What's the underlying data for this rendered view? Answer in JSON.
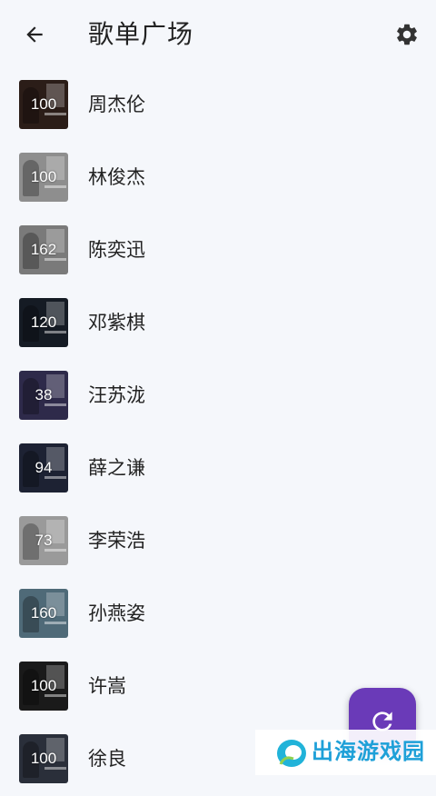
{
  "appbar": {
    "title": "歌单广场",
    "back_icon": "arrow-back-icon",
    "settings_icon": "gear-icon"
  },
  "playlists": [
    {
      "count": "100",
      "name": "周杰伦",
      "color": "#2b1d18"
    },
    {
      "count": "100",
      "name": "林俊杰",
      "color": "#8e8e8e"
    },
    {
      "count": "162",
      "name": "陈奕迅",
      "color": "#7a7a7a"
    },
    {
      "count": "120",
      "name": "邓紫棋",
      "color": "#151b24"
    },
    {
      "count": "38",
      "name": "汪苏泷",
      "color": "#2e2a4a"
    },
    {
      "count": "94",
      "name": "薛之谦",
      "color": "#1d2233"
    },
    {
      "count": "73",
      "name": "李荣浩",
      "color": "#9a9a9a"
    },
    {
      "count": "160",
      "name": "孙燕姿",
      "color": "#4f6a78"
    },
    {
      "count": "100",
      "name": "许嵩",
      "color": "#1a1a1a"
    },
    {
      "count": "100",
      "name": "徐良",
      "color": "#2a2f3a"
    }
  ],
  "fab": {
    "icon": "refresh-icon",
    "color": "#6a3ab8"
  },
  "watermark": {
    "text": "出海游戏园"
  }
}
